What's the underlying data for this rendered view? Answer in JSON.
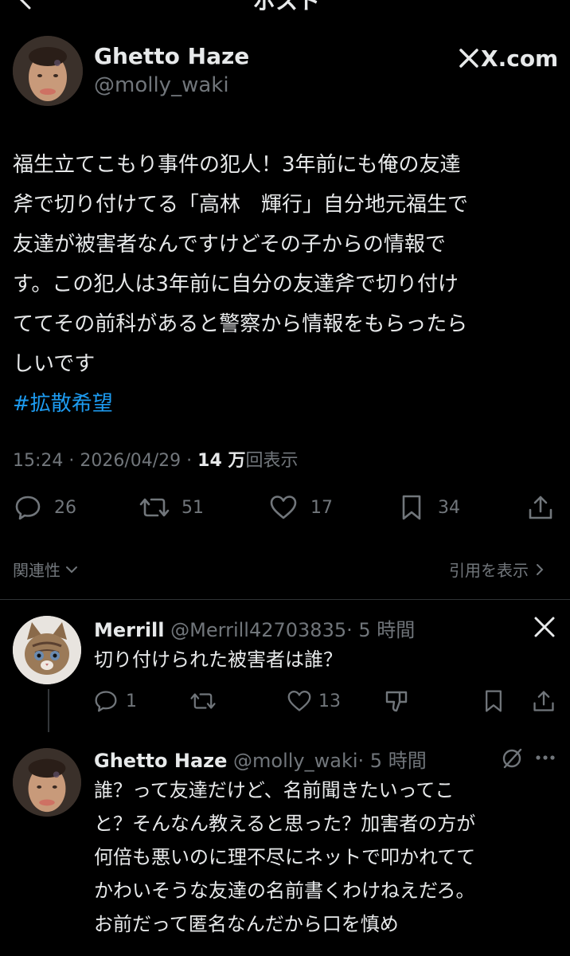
{
  "header": {
    "title": "ポスト"
  },
  "main_post": {
    "author_name": "Ghetto Haze",
    "author_handle": "@molly_waki",
    "source_label": "X.com",
    "body_lines": [
      "福生立てこもり事件の犯人！3年前にも俺の友達",
      "斧で切り付けてる「高林　輝行」自分地元福生で",
      "友達が被害者なんですけどその子からの情報で",
      "す。この犯人は3年前に自分の友達斧で切り付け",
      "ててその前科があると警察から情報をもらったら",
      "しいです"
    ],
    "hashtag": "#拡散希望",
    "timestamp": "15:24 · 2026/04/29 · ",
    "views_count": "14 万",
    "views_label": "回表示",
    "stats": {
      "replies": "26",
      "reposts": "51",
      "likes": "17",
      "bookmarks": "34"
    },
    "related_label": "関連性",
    "quotes_label": "引用を表示"
  },
  "replies": [
    {
      "author_name": "Merrill",
      "author_handle": "@Merrill42703835",
      "time": "· 5 時間",
      "text_lines": [
        "切り付けられた被害者は誰？"
      ],
      "stats": {
        "replies": "1",
        "likes": "13"
      }
    },
    {
      "author_name": "Ghetto Haze",
      "author_handle": "@molly_waki",
      "time": "· 5 時間",
      "text_lines": [
        "誰？って友達だけど、名前聞きたいってこ",
        "と？そんなん教えると思った？加害者の方が",
        "何倍も悪いのに理不尽にネットで叩かれてて",
        "かわいそうな友達の名前書くわけねえだろ。",
        "お前だって匿名なんだから口を慎め"
      ]
    }
  ],
  "icons": {
    "back": "chevron-left-icon",
    "x_logo": "x-logo-icon",
    "reply": "speech-bubble-icon",
    "repost": "repost-arrows-icon",
    "like": "heart-icon",
    "bookmark": "bookmark-icon",
    "share": "share-upload-icon",
    "downvote": "downvote-icon",
    "more": "more-dots-icon",
    "muted_grok": "circle-slash-icon"
  },
  "colors": {
    "background": "#000000",
    "text": "#e7e9ea",
    "muted": "#71767b",
    "link": "#1d9bf0",
    "divider": "#2f3336"
  }
}
